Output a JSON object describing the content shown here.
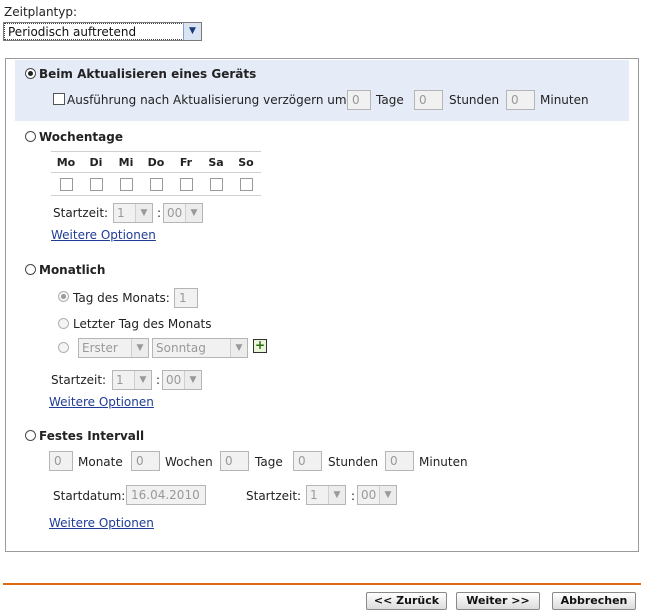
{
  "schedule_type": {
    "label": "Zeitplantyp:",
    "value": "Periodisch auftretend"
  },
  "on_refresh": {
    "label": "Beim Aktualisieren eines Geräts",
    "delay_label": "Ausführung nach Aktualisierung verzögern um:",
    "days_value": "0",
    "days_label": "Tage",
    "hours_value": "0",
    "hours_label": "Stunden",
    "minutes_value": "0",
    "minutes_label": "Minuten"
  },
  "weekdays": {
    "label": "Wochentage",
    "days": [
      "Mo",
      "Di",
      "Mi",
      "Do",
      "Fr",
      "Sa",
      "So"
    ],
    "start_label": "Startzeit:",
    "hour": "1",
    "colon": ":",
    "minute": "00",
    "more_options": "Weitere Optionen"
  },
  "monthly": {
    "label": "Monatlich",
    "day_of_month_label": "Tag des Monats:",
    "day_of_month_value": "1",
    "last_day_label": "Letzter Tag des Monats",
    "ordinal": "Erster",
    "weekday": "Sonntag",
    "start_label": "Startzeit:",
    "hour": "1",
    "colon": ":",
    "minute": "00",
    "more_options": "Weitere Optionen"
  },
  "fixed_interval": {
    "label": "Festes Intervall",
    "months_value": "0",
    "months_label": "Monate",
    "weeks_value": "0",
    "weeks_label": "Wochen",
    "days_value": "0",
    "days_label": "Tage",
    "hours_value": "0",
    "hours_label": "Stunden",
    "minutes_value": "0",
    "minutes_label": "Minuten",
    "start_date_label": "Startdatum:",
    "start_date_value": "16.04.2010",
    "start_time_label": "Startzeit:",
    "hour": "1",
    "colon": ":",
    "minute": "00",
    "more_options": "Weitere Optionen"
  },
  "buttons": {
    "back": "<< Zurück",
    "next": "Weiter >>",
    "cancel": "Abbrechen"
  },
  "colors": {
    "accent_line": "#e06a12",
    "link": "#1f3c96",
    "selected_band": "#e6ecf7"
  }
}
